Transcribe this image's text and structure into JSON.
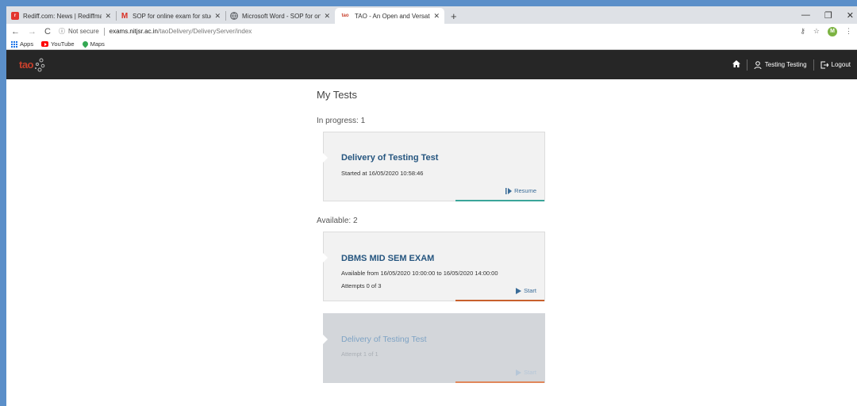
{
  "browser": {
    "tabs": [
      {
        "title": "Rediff.com: News | Rediffmail | St",
        "icon": "rediff-icon",
        "color": "#e3342f",
        "active": false
      },
      {
        "title": "SOP for online exam for students",
        "icon": "gmail-icon",
        "color": "#d93025",
        "active": false
      },
      {
        "title": "Microsoft Word - SOP for online",
        "icon": "globe-icon",
        "color": "#5f6368",
        "active": false
      },
      {
        "title": "TAO - An Open and Versatile Co",
        "icon": "tao-favicon-icon",
        "color": "#c8402c",
        "active": true
      }
    ],
    "new_tab": "+",
    "url": {
      "security": "Not secure",
      "host": "exams.nitjsr.ac.in",
      "path": "/taoDelivery/DeliveryServer/index"
    },
    "profile_initial": "M",
    "bookmarks": [
      {
        "label": "Apps",
        "icon": "apps-grid-icon"
      },
      {
        "label": "YouTube",
        "icon": "youtube-icon"
      },
      {
        "label": "Maps",
        "icon": "maps-pin-icon"
      }
    ]
  },
  "app": {
    "logo": "tao",
    "user_name": "Testing Testing",
    "logout_label": "Logout"
  },
  "page": {
    "title": "My Tests",
    "in_progress_title": "In progress: 1",
    "available_title": "Available: 2",
    "in_progress": [
      {
        "title": "Delivery of Testing Test",
        "line1": "Started at 16/05/2020 10:58:46",
        "action": "Resume",
        "bar_color": "#3aa59a"
      }
    ],
    "available": [
      {
        "title": "DBMS MID SEM EXAM",
        "line1": "Available from 16/05/2020 10:00:00 to 16/05/2020 14:00:00",
        "line2": "Attempts 0 of 3",
        "action": "Start",
        "bar_color": "#c8602c",
        "disabled": false
      },
      {
        "title": "Delivery of Testing Test",
        "line1": "Attempt 1 of 1",
        "action": "Start",
        "bar_color": "#e0875a",
        "disabled": true
      }
    ]
  }
}
